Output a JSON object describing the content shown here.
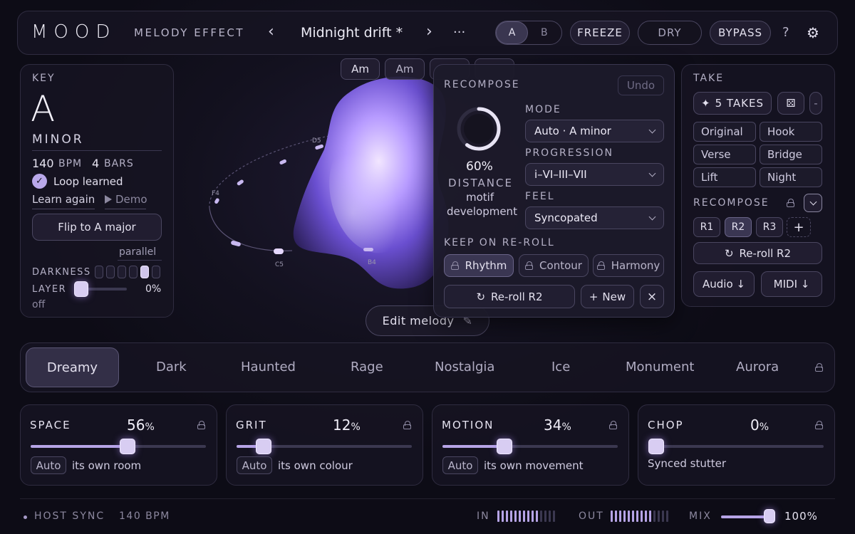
{
  "header": {
    "logo": "MOOD",
    "product": "MELODY EFFECT",
    "prev_icon": "‹",
    "preset_name": "Midnight drift *",
    "next_icon": "›",
    "more_icon": "···",
    "ab": [
      "A",
      "B"
    ],
    "freeze": "FREEZE",
    "dry": "DRY",
    "bypass": "BYPASS",
    "help": "?",
    "settings_icon": "⚙"
  },
  "key_panel": {
    "label": "KEY",
    "note": "A",
    "scale": "MINOR",
    "bpm_value": "140",
    "bpm_unit": "BPM",
    "bars_value": "4",
    "bars_unit": "BARS",
    "loop_learned": "Loop learned",
    "learn_again": "Learn again",
    "demo": "Demo",
    "flip": "Flip to A major",
    "parallel": "parallel",
    "darkness_label": "DARKNESS",
    "darkness_level": 0.8,
    "layer_label": "LAYER",
    "layer_value": "0%",
    "layer_state": "off"
  },
  "chords": [
    "Am",
    "Am"
  ],
  "orbit_labels": [
    "D5",
    "F4",
    "C5",
    "B4"
  ],
  "edit_melody": "Edit melody",
  "recompose_popup": {
    "title": "RECOMPOSE",
    "undo": "Undo",
    "distance_value": "60%",
    "distance_label": "DISTANCE",
    "distance_desc_1": "motif",
    "distance_desc_2": "development",
    "distance_level": 0.6,
    "mode_label": "MODE",
    "mode_value": "Auto · A minor",
    "progression_label": "PROGRESSION",
    "progression_value": "i–VI–III–VII",
    "feel_label": "FEEL",
    "feel_value": "Syncopated",
    "keep_label": "KEEP ON RE-ROLL",
    "keep": [
      "Rhythm",
      "Contour",
      "Harmony"
    ],
    "reroll": "Re-roll R2",
    "new": "New",
    "close": "×"
  },
  "take_panel": {
    "label": "TAKE",
    "takes_button": "5 TAKES",
    "dice_icon": "⚄",
    "minus": "-",
    "takes": [
      "Original",
      "Hook",
      "Verse",
      "Bridge",
      "Lift",
      "Night"
    ],
    "recompose_label": "RECOMPOSE",
    "slots": [
      "R1",
      "R2",
      "R3"
    ],
    "add": "+",
    "reroll": "Re-roll R2",
    "audio": "Audio ↓",
    "midi": "MIDI ↓"
  },
  "moods": [
    "Dreamy",
    "Dark",
    "Haunted",
    "Rage",
    "Nostalgia",
    "Ice",
    "Monument",
    "Aurora"
  ],
  "macros": [
    {
      "label": "SPACE",
      "value": "56",
      "unit": "%",
      "level": 0.56,
      "auto": "Auto",
      "desc": "its own room"
    },
    {
      "label": "GRIT",
      "value": "12",
      "unit": "%",
      "level": 0.12,
      "auto": "Auto",
      "desc": "its own colour"
    },
    {
      "label": "MOTION",
      "value": "34",
      "unit": "%",
      "level": 0.34,
      "auto": "Auto",
      "desc": "its own movement"
    },
    {
      "label": "CHOP",
      "value": "0",
      "unit": "%",
      "level": 0.0,
      "desc": "Synced stutter"
    }
  ],
  "footer": {
    "host_sync": "HOST SYNC",
    "bpm": "140 BPM",
    "in_label": "IN",
    "out_label": "OUT",
    "mix_label": "MIX",
    "mix_value": "100%",
    "mix_level": 1.0
  },
  "colors": {
    "accent": "#b6a4e6",
    "background": "#0d0c16",
    "panel": "#161422"
  }
}
